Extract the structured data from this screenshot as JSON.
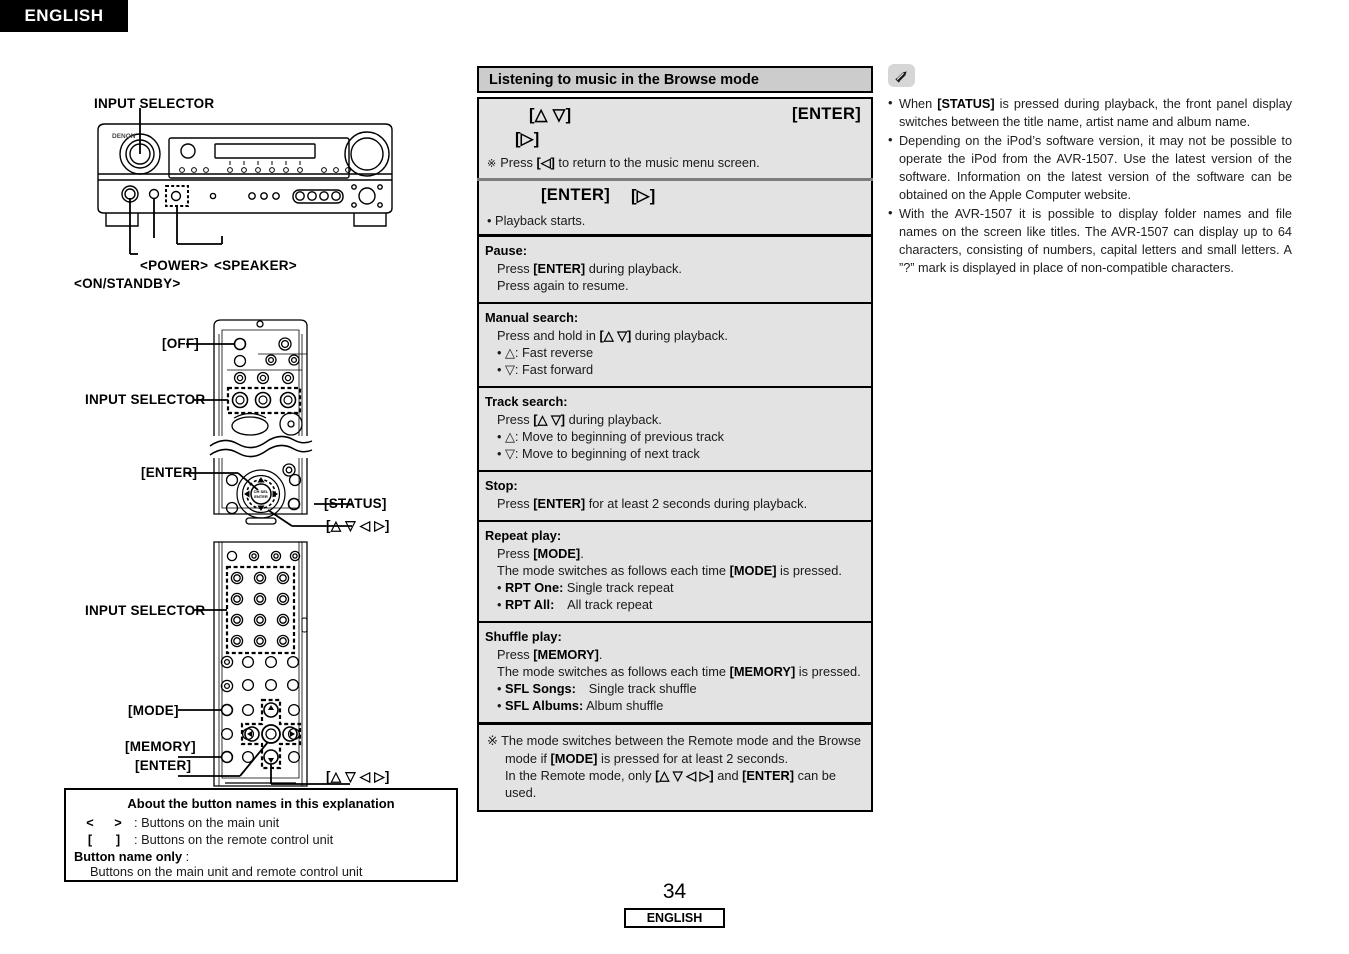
{
  "header": {
    "language_tab": "ENGLISH"
  },
  "left_column": {
    "main_unit_diagram": {
      "name": "main-unit-front-panel",
      "brand": "DENON",
      "labels": [
        {
          "text": "INPUT SELECTOR",
          "id": "input-selector-main"
        },
        {
          "text": "<POWER>",
          "id": "power"
        },
        {
          "text": "<SPEAKER>",
          "id": "speaker"
        },
        {
          "text": "<ON/STANDBY>",
          "id": "on-standby"
        }
      ]
    },
    "remote_diagram_top": {
      "name": "remote-control-upper",
      "labels": [
        {
          "text": "[OFF]",
          "id": "off"
        },
        {
          "text": "INPUT SELECTOR",
          "id": "input-selector-remote-1"
        },
        {
          "text": "[ENTER]",
          "id": "enter-1"
        },
        {
          "text": "[STATUS]",
          "id": "status"
        },
        {
          "text": "[△ ▽ ◁ ▷]",
          "id": "cursor-1"
        }
      ]
    },
    "remote_diagram_bottom": {
      "name": "remote-control-lower",
      "labels": [
        {
          "text": "INPUT SELECTOR",
          "id": "input-selector-remote-2"
        },
        {
          "text": "[MODE]",
          "id": "mode"
        },
        {
          "text": "[MEMORY]",
          "id": "memory"
        },
        {
          "text": "[ENTER]",
          "id": "enter-2"
        },
        {
          "text": "[△ ▽ ◁ ▷]",
          "id": "cursor-2"
        }
      ]
    },
    "about_box": {
      "title": "About the button names in this explanation",
      "row1_sym_open": "<",
      "row1_sym_close": ">",
      "row1_text": ": Buttons on the main unit",
      "row2_sym_open": "[",
      "row2_sym_close": "]",
      "row2_text": ": Buttons on the remote control unit",
      "row3_label": "Button name only",
      "row3_colon": ":",
      "row3_text": "Buttons on the main unit and remote control unit"
    }
  },
  "middle_column": {
    "section_title": "Listening to music in the Browse mode",
    "step1": {
      "key_updown": "[△ ▽]",
      "key_right": "[▷]",
      "key_enter": "[ENTER]",
      "note_mark": "※",
      "note_text_pre": "Press ",
      "note_key": "[◁]",
      "note_text_post": " to return to the music menu screen."
    },
    "step2": {
      "key_enter": "[ENTER]",
      "key_right": "[▷]",
      "bullet": "• Playback starts."
    },
    "items": [
      {
        "title": "Pause:",
        "lines": [
          {
            "parts": [
              {
                "t": "Press ",
                "b": false
              },
              {
                "t": "[ENTER]",
                "b": true
              },
              {
                "t": " during playback.",
                "b": false
              }
            ]
          },
          {
            "parts": [
              {
                "t": "Press again to resume.",
                "b": false
              }
            ]
          }
        ]
      },
      {
        "title": "Manual search:",
        "lines": [
          {
            "parts": [
              {
                "t": "Press and hold in ",
                "b": false
              },
              {
                "t": "[△ ▽]",
                "b": true
              },
              {
                "t": " during playback.",
                "b": false
              }
            ]
          },
          {
            "parts": [
              {
                "t": "• △: Fast reverse",
                "b": false
              }
            ]
          },
          {
            "parts": [
              {
                "t": "• ▽: Fast forward",
                "b": false
              }
            ]
          }
        ]
      },
      {
        "title": "Track search:",
        "lines": [
          {
            "parts": [
              {
                "t": "Press ",
                "b": false
              },
              {
                "t": "[△ ▽]",
                "b": true
              },
              {
                "t": " during playback.",
                "b": false
              }
            ]
          },
          {
            "parts": [
              {
                "t": "• △: Move to beginning of previous track",
                "b": false
              }
            ]
          },
          {
            "parts": [
              {
                "t": "• ▽: Move to beginning of next track",
                "b": false
              }
            ]
          }
        ]
      },
      {
        "title": "Stop:",
        "lines": [
          {
            "parts": [
              {
                "t": "Press ",
                "b": false
              },
              {
                "t": "[ENTER]",
                "b": true
              },
              {
                "t": " for at least 2 seconds during playback.",
                "b": false
              }
            ]
          }
        ]
      },
      {
        "title": "Repeat play:",
        "lines": [
          {
            "parts": [
              {
                "t": "Press ",
                "b": false
              },
              {
                "t": "[MODE]",
                "b": true
              },
              {
                "t": ".",
                "b": false
              }
            ]
          },
          {
            "parts": [
              {
                "t": "The mode switches as follows each time ",
                "b": false
              },
              {
                "t": "[MODE]",
                "b": true
              },
              {
                "t": " is pressed.",
                "b": false
              }
            ]
          },
          {
            "parts": [
              {
                "t": "• ",
                "b": false
              },
              {
                "t": "RPT One:",
                "b": true
              },
              {
                "t": " Single track repeat",
                "b": false
              }
            ]
          },
          {
            "parts": [
              {
                "t": "• ",
                "b": false
              },
              {
                "t": "RPT All:",
                "b": true
              },
              {
                "t": "  All track repeat",
                "b": false
              }
            ]
          }
        ]
      },
      {
        "title": "Shuffle play:",
        "lines": [
          {
            "parts": [
              {
                "t": "Press ",
                "b": false
              },
              {
                "t": "[MEMORY]",
                "b": true
              },
              {
                "t": ".",
                "b": false
              }
            ]
          },
          {
            "parts": [
              {
                "t": "The mode switches as follows each time ",
                "b": false
              },
              {
                "t": "[MEMORY]",
                "b": true
              },
              {
                "t": " is pressed.",
                "b": false
              }
            ]
          },
          {
            "parts": [
              {
                "t": "• ",
                "b": false
              },
              {
                "t": "SFL Songs:",
                "b": true
              },
              {
                "t": "  Single track shuffle",
                "b": false
              }
            ]
          },
          {
            "parts": [
              {
                "t": "• ",
                "b": false
              },
              {
                "t": "SFL Albums:",
                "b": true
              },
              {
                "t": " Album shuffle",
                "b": false
              }
            ]
          }
        ]
      }
    ],
    "footnote": {
      "mark": "※",
      "line1_a": "The mode switches between the Remote mode and the Browse",
      "line2_a": "mode if ",
      "line2_key": "[MODE]",
      "line2_b": " is pressed for at least 2 seconds.",
      "line3_a": "In the Remote mode, only ",
      "line3_key1": "[△ ▽ ◁ ▷]",
      "line3_b": " and ",
      "line3_key2": "[ENTER]",
      "line3_c": " can be used."
    }
  },
  "right_column": {
    "icon": "pencil-note-icon",
    "notes": [
      {
        "parts": [
          {
            "t": "When ",
            "b": false
          },
          {
            "t": "[STATUS]",
            "b": true
          },
          {
            "t": " is pressed during playback, the front panel display switches between the title name, artist name and album name.",
            "b": false
          }
        ]
      },
      {
        "parts": [
          {
            "t": "Depending on the iPod’s software version, it may not be possible to operate the iPod from the AVR-1507. Use the latest version of the software. Information on the latest version of the software can be obtained on the Apple Computer website.",
            "b": false
          }
        ]
      },
      {
        "parts": [
          {
            "t": "With the AVR-1507 it is possible to display folder names and file names on the screen like titles. The AVR-1507 can display up to 64 characters, consisting of numbers, capital letters and small letters. A ”?” mark is displayed in place of non-compatible characters.",
            "b": false
          }
        ]
      }
    ]
  },
  "footer": {
    "page_number": "34",
    "language": "ENGLISH"
  },
  "colors": {
    "panel_bg": "#e3e3e3",
    "header_bg": "#cccccc",
    "ink": "#000000",
    "grey_rule": "#7d7d7d"
  }
}
